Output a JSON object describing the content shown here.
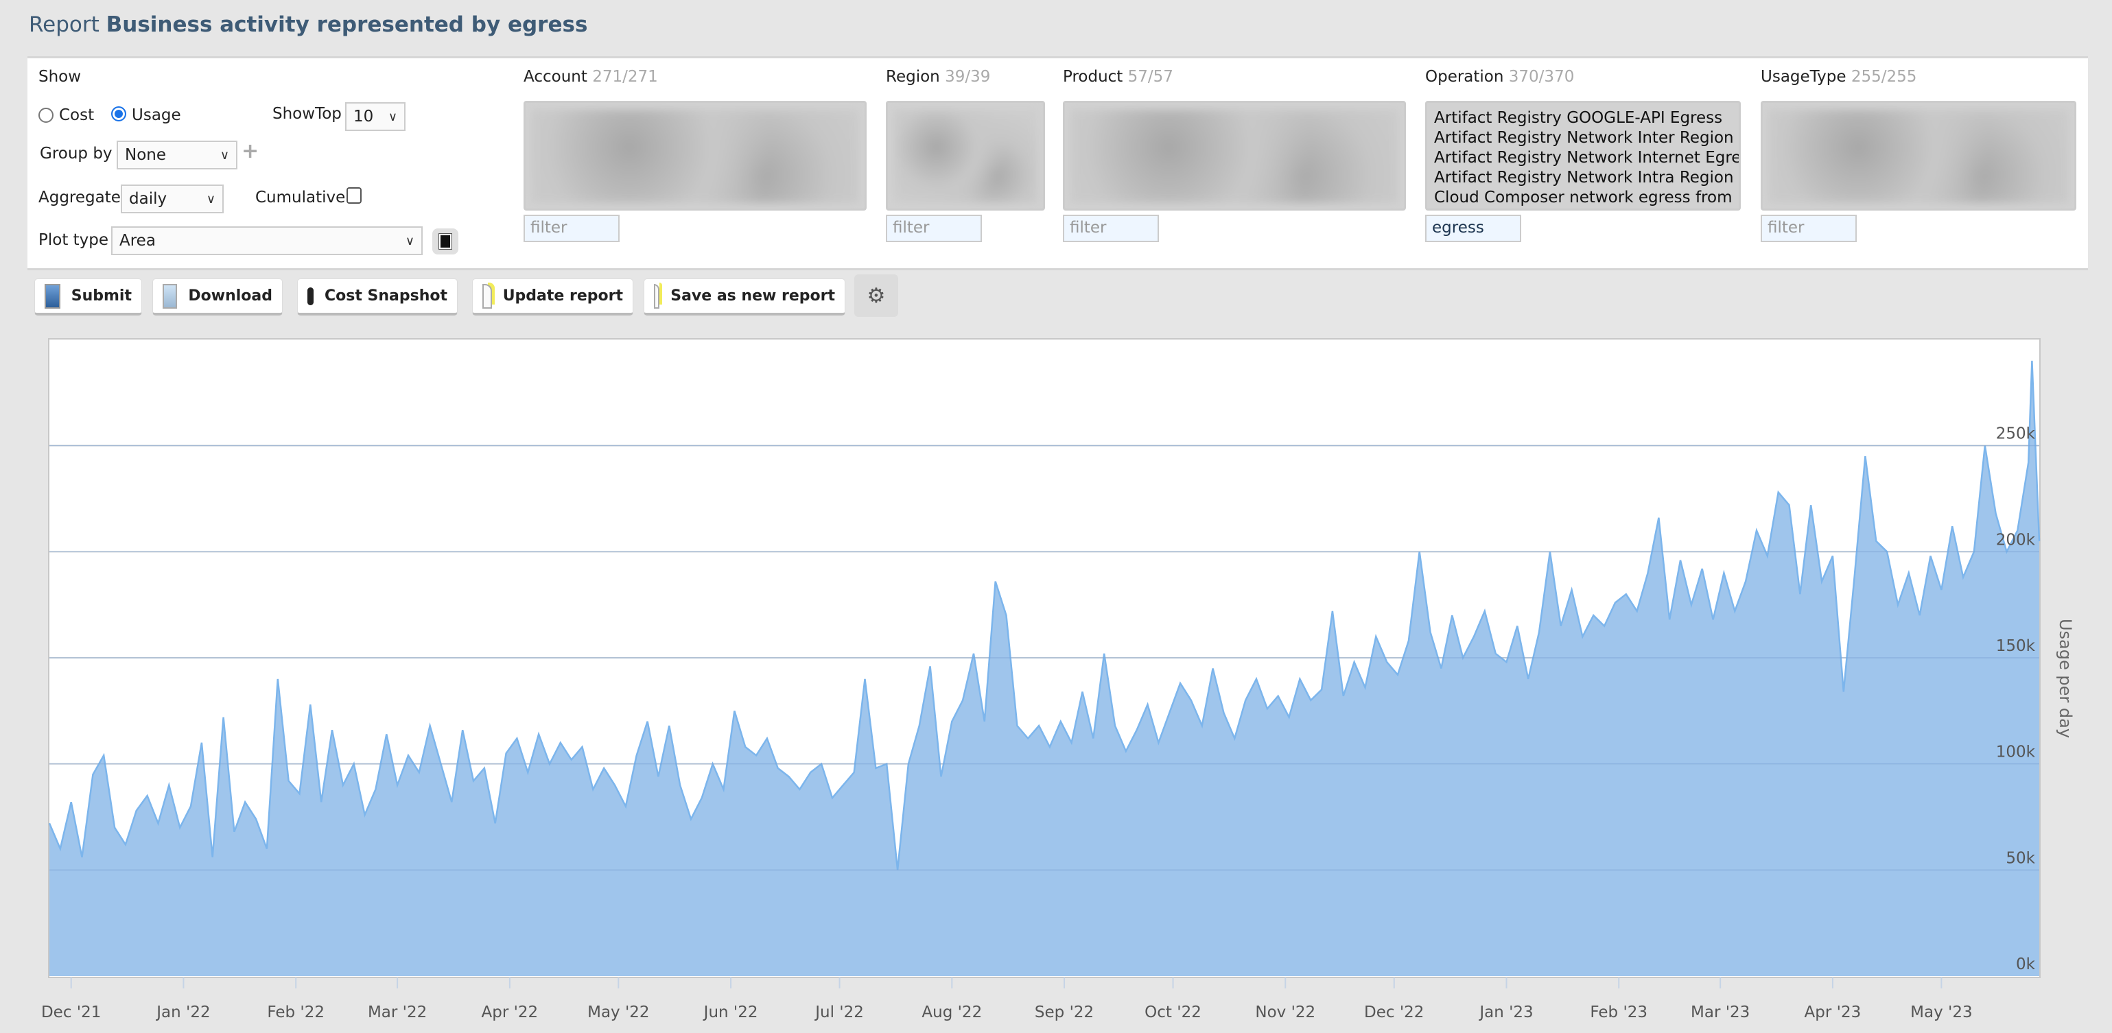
{
  "header": {
    "prefix": "Report",
    "title": "Business activity represented by egress"
  },
  "controls": {
    "show_label": "Show",
    "cost_label": "Cost",
    "usage_label": "Usage",
    "selected_show": "Usage",
    "showtop_label": "ShowTop",
    "showtop_value": "10",
    "groupby_label": "Group by",
    "groupby_value": "None",
    "aggregate_label": "Aggregate",
    "aggregate_value": "daily",
    "cumulative_label": "Cumulative",
    "cumulative_checked": false,
    "plottype_label": "Plot type",
    "plottype_value": "Area"
  },
  "filters": [
    {
      "name": "Account",
      "count": "271/271",
      "filter_placeholder": "filter",
      "filter_value": ""
    },
    {
      "name": "Region",
      "count": "39/39",
      "filter_placeholder": "filter",
      "filter_value": ""
    },
    {
      "name": "Product",
      "count": "57/57",
      "filter_placeholder": "filter",
      "filter_value": ""
    },
    {
      "name": "Operation",
      "count": "370/370",
      "filter_placeholder": "filter",
      "filter_value": "egress",
      "options": [
        "Artifact Registry GOOGLE-API Egress",
        "Artifact Registry Network Inter Region Egress",
        "Artifact Registry Network Internet Egress",
        "Artifact Registry Network Intra Region Egress",
        "Cloud Composer network egress from Location"
      ]
    },
    {
      "name": "UsageType",
      "count": "255/255",
      "filter_placeholder": "filter",
      "filter_value": ""
    }
  ],
  "toolbar": {
    "submit": "Submit",
    "download": "Download",
    "cost_snapshot": "Cost Snapshot",
    "update_report": "Update report",
    "save_new": "Save as new report"
  },
  "colors": {
    "title": "#3e5b76",
    "area_fill": "#9fc5ec",
    "area_line": "#7cb5ec",
    "radio_selected": "#1a73e8"
  },
  "chart_data": {
    "type": "area",
    "ylabel": "Usage per day",
    "ylim": [
      0,
      300000
    ],
    "yticks": [
      {
        "v": 0,
        "label": "0k"
      },
      {
        "v": 50000,
        "label": "50k"
      },
      {
        "v": 100000,
        "label": "100k"
      },
      {
        "v": 150000,
        "label": "150k"
      },
      {
        "v": 200000,
        "label": "200k"
      },
      {
        "v": 250000,
        "label": "250k"
      }
    ],
    "xlim": [
      "2021-11-25",
      "2023-05-28"
    ],
    "xticks": [
      {
        "date": "2021-12-01",
        "label": "Dec '21"
      },
      {
        "date": "2022-01-01",
        "label": "Jan '22"
      },
      {
        "date": "2022-02-01",
        "label": "Feb '22"
      },
      {
        "date": "2022-03-01",
        "label": "Mar '22"
      },
      {
        "date": "2022-04-01",
        "label": "Apr '22"
      },
      {
        "date": "2022-05-01",
        "label": "May '22"
      },
      {
        "date": "2022-06-01",
        "label": "Jun '22"
      },
      {
        "date": "2022-07-01",
        "label": "Jul '22"
      },
      {
        "date": "2022-08-01",
        "label": "Aug '22"
      },
      {
        "date": "2022-09-01",
        "label": "Sep '22"
      },
      {
        "date": "2022-10-01",
        "label": "Oct '22"
      },
      {
        "date": "2022-11-01",
        "label": "Nov '22"
      },
      {
        "date": "2022-12-01",
        "label": "Dec '22"
      },
      {
        "date": "2023-01-01",
        "label": "Jan '23"
      },
      {
        "date": "2023-02-01",
        "label": "Feb '23"
      },
      {
        "date": "2023-03-01",
        "label": "Mar '23"
      },
      {
        "date": "2023-04-01",
        "label": "Apr '23"
      },
      {
        "date": "2023-05-01",
        "label": "May '23"
      }
    ],
    "grid": true,
    "points": [
      [
        "2021-11-25",
        72000
      ],
      [
        "2021-11-28",
        60000
      ],
      [
        "2021-12-01",
        82000
      ],
      [
        "2021-12-04",
        56000
      ],
      [
        "2021-12-07",
        95000
      ],
      [
        "2021-12-10",
        104000
      ],
      [
        "2021-12-13",
        70000
      ],
      [
        "2021-12-16",
        62000
      ],
      [
        "2021-12-19",
        78000
      ],
      [
        "2021-12-22",
        85000
      ],
      [
        "2021-12-25",
        72000
      ],
      [
        "2021-12-28",
        90000
      ],
      [
        "2021-12-31",
        70000
      ],
      [
        "2022-01-03",
        80000
      ],
      [
        "2022-01-06",
        110000
      ],
      [
        "2022-01-09",
        56000
      ],
      [
        "2022-01-12",
        122000
      ],
      [
        "2022-01-15",
        68000
      ],
      [
        "2022-01-18",
        82000
      ],
      [
        "2022-01-21",
        74000
      ],
      [
        "2022-01-24",
        60000
      ],
      [
        "2022-01-27",
        140000
      ],
      [
        "2022-01-30",
        92000
      ],
      [
        "2022-02-02",
        86000
      ],
      [
        "2022-02-05",
        128000
      ],
      [
        "2022-02-08",
        82000
      ],
      [
        "2022-02-11",
        116000
      ],
      [
        "2022-02-14",
        90000
      ],
      [
        "2022-02-17",
        100000
      ],
      [
        "2022-02-20",
        76000
      ],
      [
        "2022-02-23",
        88000
      ],
      [
        "2022-02-26",
        114000
      ],
      [
        "2022-03-01",
        90000
      ],
      [
        "2022-03-04",
        104000
      ],
      [
        "2022-03-07",
        96000
      ],
      [
        "2022-03-10",
        118000
      ],
      [
        "2022-03-13",
        100000
      ],
      [
        "2022-03-16",
        82000
      ],
      [
        "2022-03-19",
        116000
      ],
      [
        "2022-03-22",
        92000
      ],
      [
        "2022-03-25",
        98000
      ],
      [
        "2022-03-28",
        72000
      ],
      [
        "2022-03-31",
        105000
      ],
      [
        "2022-04-03",
        112000
      ],
      [
        "2022-04-06",
        96000
      ],
      [
        "2022-04-09",
        114000
      ],
      [
        "2022-04-12",
        100000
      ],
      [
        "2022-04-15",
        110000
      ],
      [
        "2022-04-18",
        102000
      ],
      [
        "2022-04-21",
        108000
      ],
      [
        "2022-04-24",
        88000
      ],
      [
        "2022-04-27",
        98000
      ],
      [
        "2022-04-30",
        90000
      ],
      [
        "2022-05-03",
        80000
      ],
      [
        "2022-05-06",
        104000
      ],
      [
        "2022-05-09",
        120000
      ],
      [
        "2022-05-12",
        94000
      ],
      [
        "2022-05-15",
        118000
      ],
      [
        "2022-05-18",
        90000
      ],
      [
        "2022-05-21",
        74000
      ],
      [
        "2022-05-24",
        84000
      ],
      [
        "2022-05-27",
        100000
      ],
      [
        "2022-05-30",
        88000
      ],
      [
        "2022-06-02",
        125000
      ],
      [
        "2022-06-05",
        108000
      ],
      [
        "2022-06-08",
        104000
      ],
      [
        "2022-06-11",
        112000
      ],
      [
        "2022-06-14",
        98000
      ],
      [
        "2022-06-17",
        94000
      ],
      [
        "2022-06-20",
        88000
      ],
      [
        "2022-06-23",
        96000
      ],
      [
        "2022-06-26",
        100000
      ],
      [
        "2022-06-29",
        84000
      ],
      [
        "2022-07-02",
        90000
      ],
      [
        "2022-07-05",
        96000
      ],
      [
        "2022-07-08",
        140000
      ],
      [
        "2022-07-11",
        98000
      ],
      [
        "2022-07-14",
        100000
      ],
      [
        "2022-07-17",
        50000
      ],
      [
        "2022-07-20",
        100000
      ],
      [
        "2022-07-23",
        118000
      ],
      [
        "2022-07-26",
        146000
      ],
      [
        "2022-07-29",
        94000
      ],
      [
        "2022-08-01",
        120000
      ],
      [
        "2022-08-04",
        130000
      ],
      [
        "2022-08-07",
        152000
      ],
      [
        "2022-08-10",
        120000
      ],
      [
        "2022-08-13",
        186000
      ],
      [
        "2022-08-16",
        170000
      ],
      [
        "2022-08-19",
        118000
      ],
      [
        "2022-08-22",
        112000
      ],
      [
        "2022-08-25",
        118000
      ],
      [
        "2022-08-28",
        108000
      ],
      [
        "2022-08-31",
        120000
      ],
      [
        "2022-09-03",
        110000
      ],
      [
        "2022-09-06",
        134000
      ],
      [
        "2022-09-09",
        112000
      ],
      [
        "2022-09-12",
        152000
      ],
      [
        "2022-09-15",
        118000
      ],
      [
        "2022-09-18",
        106000
      ],
      [
        "2022-09-21",
        116000
      ],
      [
        "2022-09-24",
        128000
      ],
      [
        "2022-09-27",
        110000
      ],
      [
        "2022-09-30",
        124000
      ],
      [
        "2022-10-03",
        138000
      ],
      [
        "2022-10-06",
        130000
      ],
      [
        "2022-10-09",
        118000
      ],
      [
        "2022-10-12",
        145000
      ],
      [
        "2022-10-15",
        124000
      ],
      [
        "2022-10-18",
        112000
      ],
      [
        "2022-10-21",
        130000
      ],
      [
        "2022-10-24",
        140000
      ],
      [
        "2022-10-27",
        126000
      ],
      [
        "2022-10-30",
        132000
      ],
      [
        "2022-11-02",
        122000
      ],
      [
        "2022-11-05",
        140000
      ],
      [
        "2022-11-08",
        130000
      ],
      [
        "2022-11-11",
        135000
      ],
      [
        "2022-11-14",
        172000
      ],
      [
        "2022-11-17",
        132000
      ],
      [
        "2022-11-20",
        148000
      ],
      [
        "2022-11-23",
        136000
      ],
      [
        "2022-11-26",
        160000
      ],
      [
        "2022-11-29",
        148000
      ],
      [
        "2022-12-02",
        142000
      ],
      [
        "2022-12-05",
        158000
      ],
      [
        "2022-12-08",
        200000
      ],
      [
        "2022-12-11",
        162000
      ],
      [
        "2022-12-14",
        145000
      ],
      [
        "2022-12-17",
        170000
      ],
      [
        "2022-12-20",
        150000
      ],
      [
        "2022-12-23",
        160000
      ],
      [
        "2022-12-26",
        172000
      ],
      [
        "2022-12-29",
        152000
      ],
      [
        "2023-01-01",
        148000
      ],
      [
        "2023-01-04",
        165000
      ],
      [
        "2023-01-07",
        140000
      ],
      [
        "2023-01-10",
        162000
      ],
      [
        "2023-01-13",
        200000
      ],
      [
        "2023-01-16",
        165000
      ],
      [
        "2023-01-19",
        182000
      ],
      [
        "2023-01-22",
        160000
      ],
      [
        "2023-01-25",
        170000
      ],
      [
        "2023-01-28",
        165000
      ],
      [
        "2023-01-31",
        176000
      ],
      [
        "2023-02-03",
        180000
      ],
      [
        "2023-02-06",
        172000
      ],
      [
        "2023-02-09",
        190000
      ],
      [
        "2023-02-12",
        216000
      ],
      [
        "2023-02-15",
        168000
      ],
      [
        "2023-02-18",
        196000
      ],
      [
        "2023-02-21",
        175000
      ],
      [
        "2023-02-24",
        192000
      ],
      [
        "2023-02-27",
        168000
      ],
      [
        "2023-03-02",
        190000
      ],
      [
        "2023-03-05",
        172000
      ],
      [
        "2023-03-08",
        186000
      ],
      [
        "2023-03-11",
        210000
      ],
      [
        "2023-03-14",
        198000
      ],
      [
        "2023-03-17",
        228000
      ],
      [
        "2023-03-20",
        222000
      ],
      [
        "2023-03-23",
        180000
      ],
      [
        "2023-03-26",
        222000
      ],
      [
        "2023-03-29",
        186000
      ],
      [
        "2023-04-01",
        198000
      ],
      [
        "2023-04-04",
        134000
      ],
      [
        "2023-04-07",
        188000
      ],
      [
        "2023-04-10",
        245000
      ],
      [
        "2023-04-13",
        205000
      ],
      [
        "2023-04-16",
        200000
      ],
      [
        "2023-04-19",
        175000
      ],
      [
        "2023-04-22",
        190000
      ],
      [
        "2023-04-25",
        170000
      ],
      [
        "2023-04-28",
        198000
      ],
      [
        "2023-05-01",
        182000
      ],
      [
        "2023-05-04",
        212000
      ],
      [
        "2023-05-07",
        188000
      ],
      [
        "2023-05-10",
        200000
      ],
      [
        "2023-05-13",
        250000
      ],
      [
        "2023-05-16",
        218000
      ],
      [
        "2023-05-19",
        200000
      ],
      [
        "2023-05-22",
        210000
      ],
      [
        "2023-05-25",
        242000
      ],
      [
        "2023-05-26",
        290000
      ],
      [
        "2023-05-28",
        205000
      ]
    ]
  }
}
